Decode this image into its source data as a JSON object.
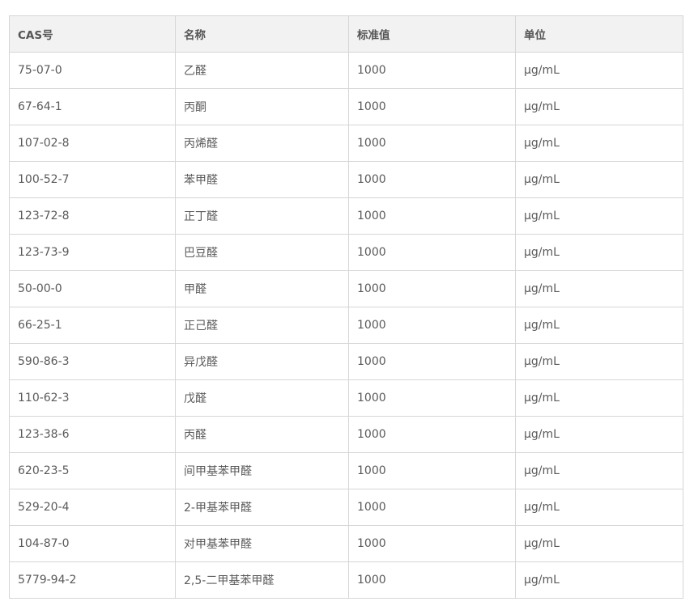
{
  "table": {
    "headers": [
      "CAS号",
      "名称",
      "标准值",
      "单位"
    ],
    "rows": [
      [
        "75-07-0",
        "乙醛",
        "1000",
        "μg/mL"
      ],
      [
        "67-64-1",
        "丙酮",
        "1000",
        "μg/mL"
      ],
      [
        "107-02-8",
        "丙烯醛",
        "1000",
        "μg/mL"
      ],
      [
        "100-52-7",
        "苯甲醛",
        "1000",
        "μg/mL"
      ],
      [
        "123-72-8",
        "正丁醛",
        "1000",
        "μg/mL"
      ],
      [
        "123-73-9",
        "巴豆醛",
        "1000",
        "μg/mL"
      ],
      [
        "50-00-0",
        "甲醛",
        "1000",
        "μg/mL"
      ],
      [
        "66-25-1",
        "正己醛",
        "1000",
        "μg/mL"
      ],
      [
        "590-86-3",
        "异戊醛",
        "1000",
        "μg/mL"
      ],
      [
        "110-62-3",
        "戊醛",
        "1000",
        "μg/mL"
      ],
      [
        "123-38-6",
        "丙醛",
        "1000",
        "μg/mL"
      ],
      [
        "620-23-5",
        "间甲基苯甲醛",
        "1000",
        "μg/mL"
      ],
      [
        "529-20-4",
        "2-甲基苯甲醛",
        "1000",
        "μg/mL"
      ],
      [
        "104-87-0",
        "对甲基苯甲醛",
        "1000",
        "μg/mL"
      ],
      [
        "5779-94-2",
        "2,5-二甲基苯甲醛",
        "1000",
        "μg/mL"
      ]
    ]
  }
}
